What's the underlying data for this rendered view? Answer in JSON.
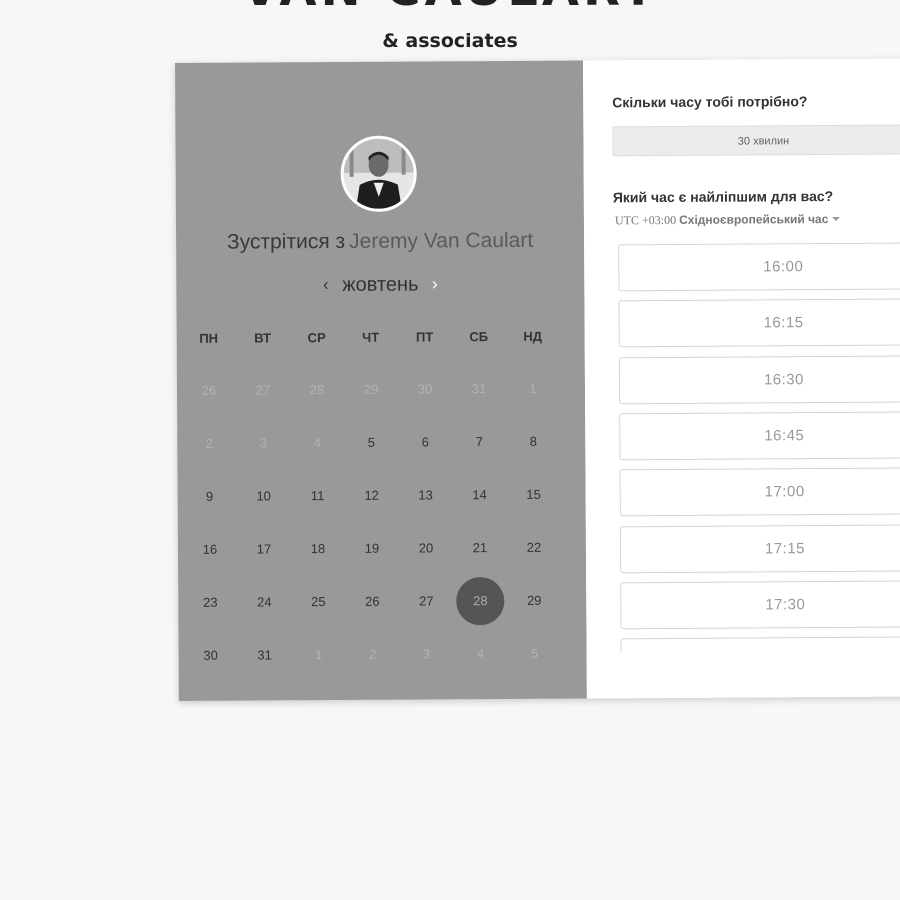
{
  "brand": {
    "title": "VAN CAULART",
    "subtitle": "& associates"
  },
  "calendar": {
    "meet_prefix": "Зустрітися з",
    "host_name": "Jeremy Van Caulart",
    "month": "жовтень",
    "prev_icon": "‹",
    "next_icon": "›",
    "weekdays": [
      "ПН",
      "ВТ",
      "СР",
      "ЧТ",
      "ПТ",
      "СБ",
      "НД"
    ],
    "weeks": [
      [
        {
          "d": "26",
          "o": 1
        },
        {
          "d": "27",
          "o": 1
        },
        {
          "d": "28",
          "o": 1
        },
        {
          "d": "29",
          "o": 1
        },
        {
          "d": "30",
          "o": 1
        },
        {
          "d": "31",
          "o": 1
        },
        {
          "d": "1",
          "o": 1
        }
      ],
      [
        {
          "d": "2",
          "o": 1
        },
        {
          "d": "3",
          "o": 1
        },
        {
          "d": "4",
          "o": 1
        },
        {
          "d": "5",
          "o": 0
        },
        {
          "d": "6",
          "o": 0
        },
        {
          "d": "7",
          "o": 0
        },
        {
          "d": "8",
          "o": 0
        }
      ],
      [
        {
          "d": "9",
          "o": 0
        },
        {
          "d": "10",
          "o": 0
        },
        {
          "d": "11",
          "o": 0
        },
        {
          "d": "12",
          "o": 0
        },
        {
          "d": "13",
          "o": 0
        },
        {
          "d": "14",
          "o": 0
        },
        {
          "d": "15",
          "o": 0
        }
      ],
      [
        {
          "d": "16",
          "o": 0
        },
        {
          "d": "17",
          "o": 0
        },
        {
          "d": "18",
          "o": 0
        },
        {
          "d": "19",
          "o": 0
        },
        {
          "d": "20",
          "o": 0
        },
        {
          "d": "21",
          "o": 0
        },
        {
          "d": "22",
          "o": 0
        }
      ],
      [
        {
          "d": "23",
          "o": 0
        },
        {
          "d": "24",
          "o": 0
        },
        {
          "d": "25",
          "o": 0
        },
        {
          "d": "26",
          "o": 0
        },
        {
          "d": "27",
          "o": 0
        },
        {
          "d": "28",
          "o": 0,
          "sel": 1
        },
        {
          "d": "29",
          "o": 0
        }
      ],
      [
        {
          "d": "30",
          "o": 0
        },
        {
          "d": "31",
          "o": 0
        },
        {
          "d": "1",
          "o": 1
        },
        {
          "d": "2",
          "o": 1
        },
        {
          "d": "3",
          "o": 1
        },
        {
          "d": "4",
          "o": 1
        },
        {
          "d": "5",
          "o": 1
        }
      ]
    ]
  },
  "booking": {
    "duration_question": "Скільки часу тобі потрібно?",
    "duration_value": "30 хвилин",
    "time_question": "Який час є найліпшим для вас?",
    "tz_offset": "UTC +03:00",
    "tz_name": "Східноєвропейський час",
    "slots": [
      "16:00",
      "16:15",
      "16:30",
      "16:45",
      "17:00",
      "17:15",
      "17:30",
      ""
    ]
  }
}
